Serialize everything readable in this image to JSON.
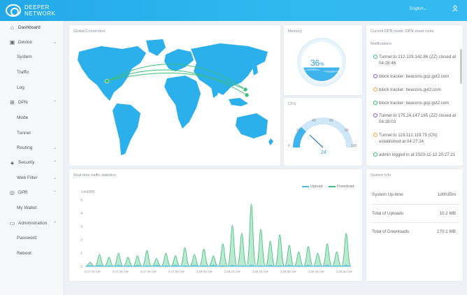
{
  "header": {
    "logo_line1": "DEEPER",
    "logo_line2": "NETWORK",
    "language": "English",
    "language_chevron": "⌄"
  },
  "sidebar": {
    "items": [
      {
        "label": "Dashboard",
        "icon": "home-icon"
      },
      {
        "label": "Device",
        "icon": "device-icon"
      },
      {
        "label": "System"
      },
      {
        "label": "Traffic"
      },
      {
        "label": "Log"
      },
      {
        "label": "DPN",
        "icon": "dpn-icon"
      },
      {
        "label": "Mode"
      },
      {
        "label": "Tunnel"
      },
      {
        "label": "Routing"
      },
      {
        "label": "Security",
        "icon": "lock-icon"
      },
      {
        "label": "Web Filter"
      },
      {
        "label": "DPR",
        "icon": "dpr-icon"
      },
      {
        "label": "My Wallet"
      },
      {
        "label": "Administration",
        "icon": "monitor-icon"
      },
      {
        "label": "Password"
      },
      {
        "label": "Reboot"
      }
    ]
  },
  "global_connection": {
    "title": "Global Connection"
  },
  "memory": {
    "title": "Memory",
    "value": "36",
    "unit": "%",
    "level_percent": 36
  },
  "cpu": {
    "title": "CPU",
    "value": "24",
    "ticks": [
      "0",
      "20",
      "40",
      "60",
      "80",
      "100"
    ],
    "level_percent": 24
  },
  "notifications": {
    "mode_title": "Current DPN mode: DPN smart route",
    "title": "Notifications",
    "items": [
      {
        "text": "Tunnel to 212.129.142.86 (ZZ) closed at 04:28:46",
        "color": "#3cbf7a"
      },
      {
        "text": "block tracker: beacons.gcp.gvt2.com",
        "color": "#7b5ce0"
      },
      {
        "text": "block tracker: beacons.gvt2.com",
        "color": "#f0a040"
      },
      {
        "text": "block tracker: beacons.gcp.gvt2.com",
        "color": "#3cbf7a"
      },
      {
        "text": "Tunnel to 175.24.147.165 (ZZ) closed at 04:28:03",
        "color": "#7b5ce0"
      },
      {
        "text": "Tunnel to 119.112.119.79 (CN) established at 04:27:24",
        "color": "#f0a040"
      },
      {
        "text": "admin logged in at 2020-11-12 20:27:21",
        "color": "#3cbf7a"
      }
    ]
  },
  "traffic": {
    "title": "Real-time traffic statistics",
    "upload_label": "Upload",
    "download_label": "Download",
    "unit": "Unit(MB)",
    "y_ticks": [
      "0",
      "1",
      "2",
      "3",
      "4",
      "5"
    ],
    "x_ticks": [
      "4:27:16 AM",
      "4:27:26 AM",
      "4:27:46 AM",
      "4:27:56 AM",
      "4:28:06 AM",
      "4:28:16 AM",
      "4:28:26 AM",
      "4:28:36 AM",
      "4:28:46 AM",
      "4:28:56 AM"
    ],
    "upload_color": "#4db8e8",
    "download_color": "#3cbf7a"
  },
  "chart_data": {
    "type": "area",
    "title": "Real-time traffic statistics",
    "ylabel": "Unit(MB)",
    "ylim": [
      0,
      5
    ],
    "x": [
      "4:27:16 AM",
      "4:27:26 AM",
      "4:27:46 AM",
      "4:27:56 AM",
      "4:28:06 AM",
      "4:28:16 AM",
      "4:28:26 AM",
      "4:28:36 AM",
      "4:28:46 AM",
      "4:28:56 AM"
    ],
    "series": [
      {
        "name": "Download",
        "values": [
          0.3,
          0.9,
          0.7,
          1.0,
          0.7,
          0.8,
          1.2,
          0.6,
          1.0,
          0.8,
          1.4,
          0.9,
          1.3,
          0.8,
          1.7,
          3.1,
          2.5,
          4.7,
          2.8,
          1.9,
          2.4,
          1.6,
          1.1,
          1.5,
          1.0,
          1.7,
          1.1,
          2.5
        ]
      },
      {
        "name": "Upload",
        "values": [
          0.05,
          0.1,
          0.05,
          0.1,
          0.05,
          0.1,
          0.05,
          0.1,
          0.05,
          0.1,
          0.05,
          0.1,
          0.05,
          0.1,
          0.05,
          0.1,
          0.05,
          0.1,
          0.05,
          0.1,
          0.05,
          0.1,
          0.05,
          0.1,
          0.05,
          0.1,
          0.05,
          0.1
        ]
      }
    ]
  },
  "system_info": {
    "title": "System Info",
    "rows": [
      {
        "label": "System Up-time",
        "value": "1d0h35m"
      },
      {
        "label": "Total of Uploads",
        "value": "10.2 MB"
      },
      {
        "label": "Total of Downloads",
        "value": "170.1 MB"
      }
    ]
  }
}
